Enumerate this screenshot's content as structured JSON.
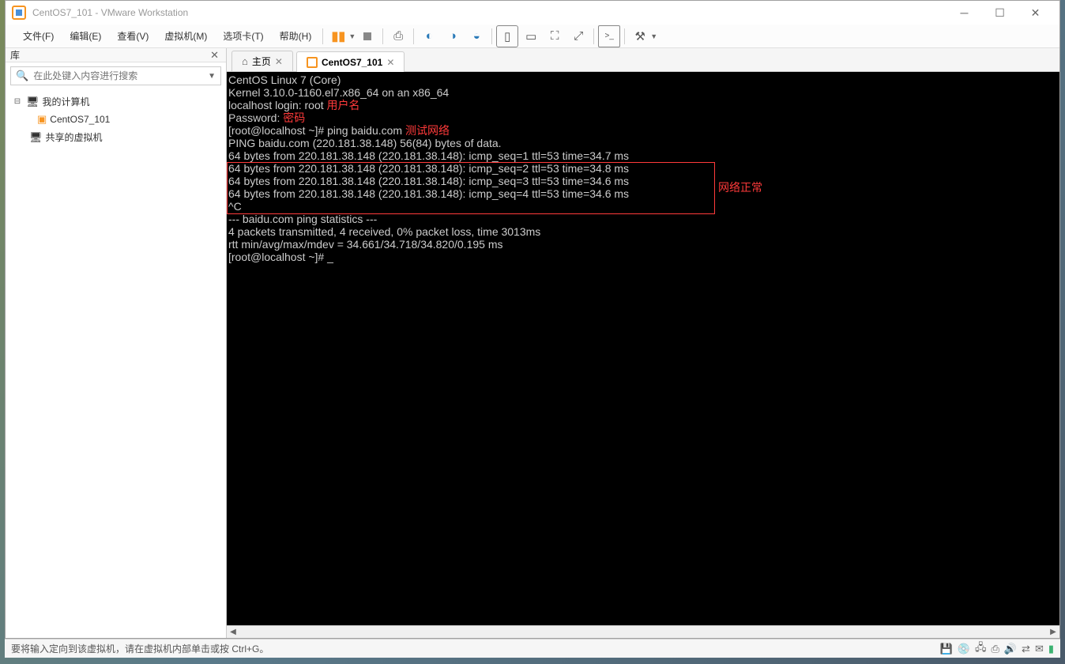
{
  "titlebar": {
    "text": "CentOS7_101 - VMware Workstation"
  },
  "menus": {
    "file": "文件(F)",
    "edit": "编辑(E)",
    "view": "查看(V)",
    "vm": "虚拟机(M)",
    "tabs": "选项卡(T)",
    "help": "帮助(H)"
  },
  "sidebar": {
    "title": "库",
    "search_placeholder": "在此处键入内容进行搜索",
    "tree": {
      "root": "我的计算机",
      "vm": "CentOS7_101",
      "shared": "共享的虚拟机"
    }
  },
  "tabs": {
    "home": "主页",
    "vm": "CentOS7_101"
  },
  "terminal": {
    "line1": "CentOS Linux 7 (Core)",
    "line2": "Kernel 3.10.0-1160.el7.x86_64 on an x86_64",
    "line3": "",
    "line4": "localhost login: root ",
    "line5": "Password: ",
    "line6": "[root@localhost ~]# ping baidu.com ",
    "line7": "PING baidu.com (220.181.38.148) 56(84) bytes of data.",
    "line8": "64 bytes from 220.181.38.148 (220.181.38.148): icmp_seq=1 ttl=53 time=34.7 ms",
    "line9": "64 bytes from 220.181.38.148 (220.181.38.148): icmp_seq=2 ttl=53 time=34.8 ms",
    "line10": "64 bytes from 220.181.38.148 (220.181.38.148): icmp_seq=3 ttl=53 time=34.6 ms",
    "line11": "64 bytes from 220.181.38.148 (220.181.38.148): icmp_seq=4 ttl=53 time=34.6 ms",
    "line12": "^C",
    "line13": "--- baidu.com ping statistics ---",
    "line14": "4 packets transmitted, 4 received, 0% packet loss, time 3013ms",
    "line15": "rtt min/avg/max/mdev = 34.661/34.718/34.820/0.195 ms",
    "line16": "[root@localhost ~]# _",
    "annot_user": "用户名",
    "annot_pwd": "密码",
    "annot_net": "测试网络",
    "annot_ok": "网络正常"
  },
  "statusbar": {
    "text": "要将输入定向到该虚拟机，请在虚拟机内部单击或按 Ctrl+G。"
  }
}
